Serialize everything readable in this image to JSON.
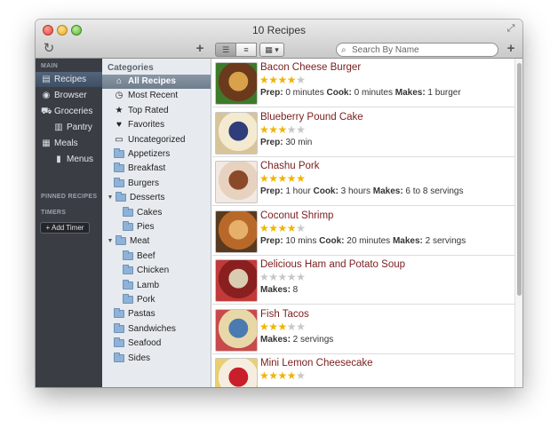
{
  "window": {
    "title": "10 Recipes"
  },
  "toolbar": {
    "refresh_icon": "↻",
    "add_recipe_icon": "+",
    "add_icon": "+",
    "view_list_icon": "☰",
    "view_rows_icon": "≡",
    "view_grid_icon": "▦ ▾",
    "search_placeholder": "Search By Name",
    "search_icon": "⌕",
    "fullscreen_icon": "⤢"
  },
  "sidebar": {
    "main_header": "MAIN",
    "items": [
      {
        "label": "Recipes",
        "icon": "▤"
      },
      {
        "label": "Browser",
        "icon": "◉"
      },
      {
        "label": "Groceries",
        "icon": "⛟"
      },
      {
        "label": "Pantry",
        "icon": "▥"
      },
      {
        "label": "Meals",
        "icon": "▦"
      },
      {
        "label": "Menus",
        "icon": "▮"
      }
    ],
    "pinned_header": "PINNED RECIPES",
    "timers_header": "TIMERS",
    "add_timer": "+ Add Timer"
  },
  "categories": {
    "title": "Categories",
    "items": [
      {
        "label": "All Recipes",
        "icon": "⌂"
      },
      {
        "label": "Most Recent",
        "icon": "◷"
      },
      {
        "label": "Top Rated",
        "icon": "★"
      },
      {
        "label": "Favorites",
        "icon": "♥"
      },
      {
        "label": "Uncategorized",
        "icon": "▭"
      },
      {
        "label": "Appetizers"
      },
      {
        "label": "Breakfast"
      },
      {
        "label": "Burgers"
      },
      {
        "label": "Desserts",
        "disclosure": "▼"
      },
      {
        "label": "Cakes"
      },
      {
        "label": "Pies"
      },
      {
        "label": "Meat",
        "disclosure": "▼"
      },
      {
        "label": "Beef"
      },
      {
        "label": "Chicken"
      },
      {
        "label": "Lamb"
      },
      {
        "label": "Pork"
      },
      {
        "label": "Pastas"
      },
      {
        "label": "Sandwiches"
      },
      {
        "label": "Seafood"
      },
      {
        "label": "Sides"
      }
    ]
  },
  "recipes": [
    {
      "name": "Bacon Cheese Burger",
      "rating": 4,
      "meta": [
        {
          "k": "Prep:",
          "v": " 0 minutes "
        },
        {
          "k": "Cook:",
          "v": " 0 minutes "
        },
        {
          "k": "Makes:",
          "v": " 1 burger"
        }
      ],
      "colors": [
        "#6b3a1c",
        "#d9a24a",
        "#3d7a2a"
      ]
    },
    {
      "name": "Blueberry Pound Cake",
      "rating": 3,
      "meta": [
        {
          "k": "Prep:",
          "v": " 30 min"
        }
      ],
      "colors": [
        "#f3ead0",
        "#2f3e7a",
        "#d8c49a"
      ]
    },
    {
      "name": "Chashu Pork",
      "rating": 5,
      "meta": [
        {
          "k": "Prep:",
          "v": " 1 hour "
        },
        {
          "k": "Cook:",
          "v": " 3 hours "
        },
        {
          "k": "Makes:",
          "v": " 6 to 8 servings"
        }
      ],
      "colors": [
        "#e7d2c0",
        "#8a4a2a",
        "#f2e9e2"
      ]
    },
    {
      "name": "Coconut Shrimp",
      "rating": 4,
      "meta": [
        {
          "k": "Prep:",
          "v": " 10 mins "
        },
        {
          "k": "Cook:",
          "v": " 20 minutes "
        },
        {
          "k": "Makes:",
          "v": " 2 servings"
        }
      ],
      "colors": [
        "#b8692a",
        "#e6b06a",
        "#5a3a1e"
      ]
    },
    {
      "name": "Delicious Ham and Potato Soup",
      "rating": 0,
      "meta": [
        {
          "k": "Makes:",
          "v": " 8"
        }
      ],
      "colors": [
        "#8a1f1f",
        "#d9ccb0",
        "#c23a3a"
      ]
    },
    {
      "name": "Fish Tacos",
      "rating": 3,
      "meta": [
        {
          "k": "Makes:",
          "v": " 2 servings"
        }
      ],
      "colors": [
        "#e8d8a8",
        "#4a7ab0",
        "#c84a4a"
      ]
    },
    {
      "name": "Mini Lemon Cheesecake",
      "rating": 4,
      "meta": [],
      "colors": [
        "#f5eee0",
        "#c81f2a",
        "#e8d070"
      ]
    }
  ]
}
